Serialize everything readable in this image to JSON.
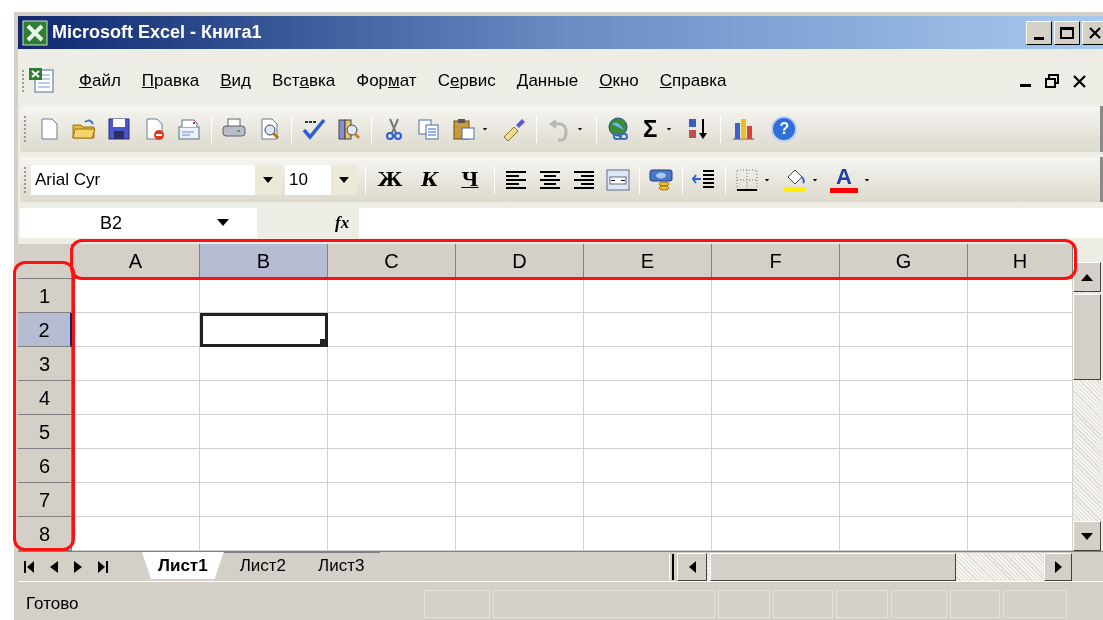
{
  "window": {
    "title": "Microsoft Excel - Книга1"
  },
  "menu": [
    {
      "key": "Ф",
      "post": "айл"
    },
    {
      "key": "П",
      "post": "равка"
    },
    {
      "key": "В",
      "post": "ид"
    },
    {
      "pre": "Вст",
      "key": "а",
      "post": "вка"
    },
    {
      "pre": "Фор",
      "key": "м",
      "post": "ат"
    },
    {
      "pre": "С",
      "key": "е",
      "post": "рвис"
    },
    {
      "key": "Д",
      "post": "анные"
    },
    {
      "key": "О",
      "post": "кно"
    },
    {
      "key": "С",
      "post": "правка"
    }
  ],
  "standard_toolbar": {
    "sum": "Σ",
    "help": "?"
  },
  "formatting_toolbar": {
    "font": "Arial Cyr",
    "size": "10",
    "bold": "Ж",
    "italic": "К",
    "underline": "Ч",
    "font_color": "A"
  },
  "formula_bar": {
    "name_box": "B2",
    "fx": "fx"
  },
  "columns": [
    {
      "label": "A",
      "selected": false
    },
    {
      "label": "B",
      "selected": true
    },
    {
      "label": "C",
      "selected": false
    },
    {
      "label": "D",
      "selected": false
    },
    {
      "label": "E",
      "selected": false
    },
    {
      "label": "F",
      "selected": false
    },
    {
      "label": "G",
      "selected": false
    },
    {
      "label": "H",
      "selected": false
    }
  ],
  "rows": [
    {
      "label": "1",
      "selected": false
    },
    {
      "label": "2",
      "selected": true
    },
    {
      "label": "3",
      "selected": false
    },
    {
      "label": "4",
      "selected": false
    },
    {
      "label": "5",
      "selected": false
    },
    {
      "label": "6",
      "selected": false
    },
    {
      "label": "7",
      "selected": false
    },
    {
      "label": "8",
      "selected": false
    }
  ],
  "sheet_tabs": [
    {
      "label": "Лист1",
      "selected": true
    },
    {
      "label": "Лист2",
      "selected": false
    },
    {
      "label": "Лист3",
      "selected": false
    }
  ],
  "status_bar": {
    "text": "Готово"
  }
}
